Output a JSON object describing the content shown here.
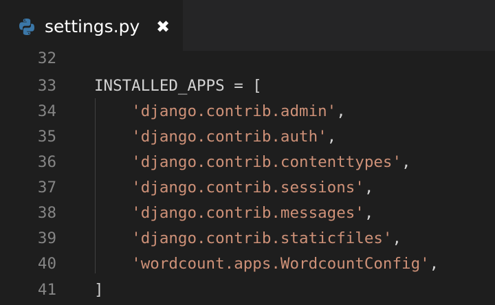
{
  "tab": {
    "icon": "python-icon",
    "label": "settings.py",
    "close": "✖"
  },
  "lines": [
    {
      "number": "32",
      "pre": "",
      "string": "",
      "post": ""
    },
    {
      "number": "33",
      "pre": "INSTALLED_APPS = [",
      "string": "",
      "post": ""
    },
    {
      "number": "34",
      "pre": "    ",
      "string": "'django.contrib.admin'",
      "post": ","
    },
    {
      "number": "35",
      "pre": "    ",
      "string": "'django.contrib.auth'",
      "post": ","
    },
    {
      "number": "36",
      "pre": "    ",
      "string": "'django.contrib.contenttypes'",
      "post": ","
    },
    {
      "number": "37",
      "pre": "    ",
      "string": "'django.contrib.sessions'",
      "post": ","
    },
    {
      "number": "38",
      "pre": "    ",
      "string": "'django.contrib.messages'",
      "post": ","
    },
    {
      "number": "39",
      "pre": "    ",
      "string": "'django.contrib.staticfiles'",
      "post": ","
    },
    {
      "number": "40",
      "pre": "    ",
      "string": "'wordcount.apps.WordcountConfig'",
      "post": ","
    },
    {
      "number": "41",
      "pre": "]",
      "string": "",
      "post": ""
    }
  ],
  "colors": {
    "background": "#1e1e1e",
    "tabbar": "#252526",
    "line_number": "#858585",
    "code_text": "#d4d4d4",
    "string": "#ce9178",
    "python_blue": "#3b77a8",
    "python_yellow": "#f7c93e"
  }
}
